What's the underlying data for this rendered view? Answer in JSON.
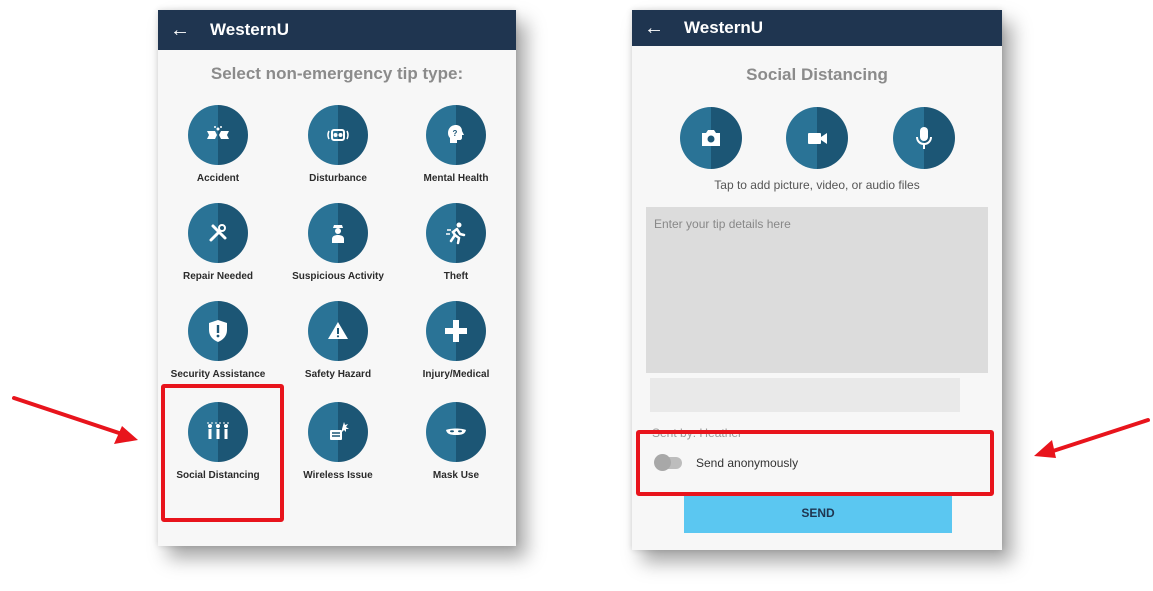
{
  "left_screen": {
    "app_title": "WesternU",
    "heading": "Select non-emergency tip type:",
    "tiles": [
      {
        "label": "Accident",
        "icon": "accident-icon"
      },
      {
        "label": "Disturbance",
        "icon": "disturbance-icon"
      },
      {
        "label": "Mental Health",
        "icon": "mental-health-icon"
      },
      {
        "label": "Repair Needed",
        "icon": "repair-icon"
      },
      {
        "label": "Suspicious Activity",
        "icon": "suspicious-person-icon"
      },
      {
        "label": "Theft",
        "icon": "running-thief-icon"
      },
      {
        "label": "Security Assistance",
        "icon": "shield-icon"
      },
      {
        "label": "Safety Hazard",
        "icon": "warning-triangle-icon"
      },
      {
        "label": "Injury/Medical",
        "icon": "medical-cross-icon"
      },
      {
        "label": "Social Distancing",
        "icon": "people-distancing-icon"
      },
      {
        "label": "Wireless Issue",
        "icon": "wireless-device-icon"
      },
      {
        "label": "Mask Use",
        "icon": "mask-icon"
      }
    ]
  },
  "right_screen": {
    "app_title": "WesternU",
    "heading": "Social Distancing",
    "media_buttons": [
      {
        "icon": "camera-icon"
      },
      {
        "icon": "video-camera-icon"
      },
      {
        "icon": "microphone-icon"
      }
    ],
    "media_hint": "Tap to add picture, video, or audio files",
    "tip_placeholder": "Enter your tip details here",
    "sent_by": "Sent by: Heather",
    "anonymous_label": "Send anonymously",
    "anonymous_enabled": false,
    "send_label": "SEND"
  },
  "colors": {
    "app_bar": "#1f3550",
    "icon_light": "#2a7396",
    "icon_dark": "#1c5675",
    "send_button": "#5bc7f1",
    "highlight": "#e8141c"
  }
}
